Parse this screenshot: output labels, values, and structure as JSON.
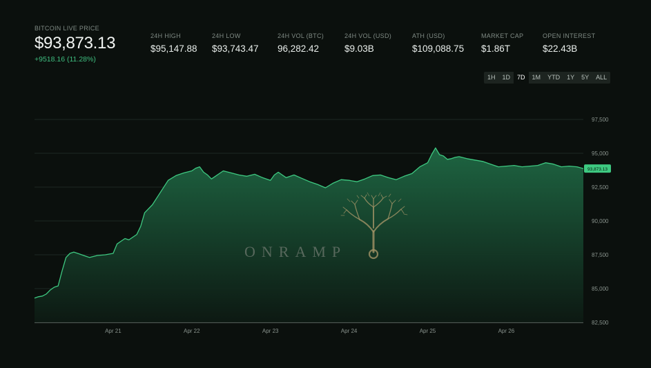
{
  "header": {
    "label": "BITCOIN LIVE PRICE",
    "price": "$93,873.13",
    "change": "+9518.16 (11.28%)"
  },
  "stats": [
    {
      "label": "24H HIGH",
      "value": "$95,147.88"
    },
    {
      "label": "24H LOW",
      "value": "$93,743.47"
    },
    {
      "label": "24H VOL (BTC)",
      "value": "96,282.42"
    },
    {
      "label": "24H VOL (USD)",
      "value": "$9.03B"
    },
    {
      "label": "ATH (USD)",
      "value": "$109,088.75"
    },
    {
      "label": "MARKET CAP",
      "value": "$1.86T"
    },
    {
      "label": "OPEN INTEREST",
      "value": "$22.43B"
    }
  ],
  "ranges": {
    "options": [
      "1H",
      "1D",
      "7D",
      "1M",
      "YTD",
      "1Y",
      "5Y",
      "ALL"
    ],
    "selected": "7D"
  },
  "watermark": "ONRAMP",
  "colors": {
    "line": "#3ec981",
    "area_top": "#1f6a45",
    "area_bottom": "#0d1a13",
    "up": "#3fbf80",
    "background": "#0b100d"
  },
  "chart_data": {
    "type": "area",
    "title": "",
    "xlabel": "",
    "ylabel": "",
    "ylim": [
      82500,
      97500
    ],
    "yticks": [
      "97,500",
      "95,000",
      "92,500",
      "90,000",
      "87,500",
      "85,000",
      "82,500"
    ],
    "ytick_values": [
      97500,
      95000,
      92500,
      90000,
      87500,
      85000,
      82500
    ],
    "xticks": [
      {
        "label": "Apr 21",
        "x": 1
      },
      {
        "label": "Apr 22",
        "x": 2
      },
      {
        "label": "Apr 23",
        "x": 3
      },
      {
        "label": "Apr 24",
        "x": 4
      },
      {
        "label": "Apr 25",
        "x": 5
      },
      {
        "label": "Apr 26",
        "x": 6
      }
    ],
    "xlim": [
      0.0,
      6.98
    ],
    "current_label": "93,873.13",
    "current_value": 93873.13,
    "series": [
      {
        "x": [
          0.0,
          0.05,
          0.1,
          0.15,
          0.2,
          0.25,
          0.3,
          0.35,
          0.4,
          0.45,
          0.5,
          0.55,
          0.6,
          0.65,
          0.7,
          0.8,
          0.9,
          1.0,
          1.05,
          1.1,
          1.15,
          1.2,
          1.25,
          1.3,
          1.35,
          1.4,
          1.5,
          1.6,
          1.7,
          1.8,
          1.9,
          2.0,
          2.05,
          2.1,
          2.15,
          2.2,
          2.25,
          2.3,
          2.35,
          2.4,
          2.5,
          2.6,
          2.7,
          2.8,
          2.9,
          3.0,
          3.05,
          3.1,
          3.15,
          3.2,
          3.3,
          3.4,
          3.5,
          3.6,
          3.7,
          3.8,
          3.9,
          4.0,
          4.1,
          4.2,
          4.3,
          4.4,
          4.5,
          4.6,
          4.7,
          4.8,
          4.9,
          5.0,
          5.05,
          5.1,
          5.15,
          5.2,
          5.25,
          5.3,
          5.35,
          5.4,
          5.5,
          5.6,
          5.7,
          5.8,
          5.9,
          6.0,
          6.1,
          6.2,
          6.3,
          6.4,
          6.5,
          6.6,
          6.7,
          6.8,
          6.9,
          6.98
        ],
        "y": [
          84300,
          84400,
          84450,
          84600,
          84900,
          85100,
          85200,
          86300,
          87300,
          87600,
          87700,
          87600,
          87500,
          87400,
          87300,
          87450,
          87500,
          87600,
          88300,
          88500,
          88700,
          88600,
          88800,
          89000,
          89600,
          90600,
          91200,
          92100,
          93000,
          93350,
          93550,
          93700,
          93900,
          94000,
          93600,
          93400,
          93100,
          93300,
          93500,
          93700,
          93550,
          93400,
          93300,
          93450,
          93200,
          93000,
          93400,
          93600,
          93400,
          93200,
          93400,
          93150,
          92900,
          92700,
          92450,
          92800,
          93050,
          93000,
          92900,
          93100,
          93350,
          93400,
          93200,
          93050,
          93300,
          93500,
          94000,
          94300,
          94900,
          95400,
          94900,
          94800,
          94550,
          94600,
          94700,
          94750,
          94600,
          94500,
          94400,
          94200,
          94000,
          94050,
          94100,
          94000,
          94050,
          94100,
          94300,
          94200,
          94000,
          94050,
          94000,
          93873
        ]
      }
    ]
  }
}
